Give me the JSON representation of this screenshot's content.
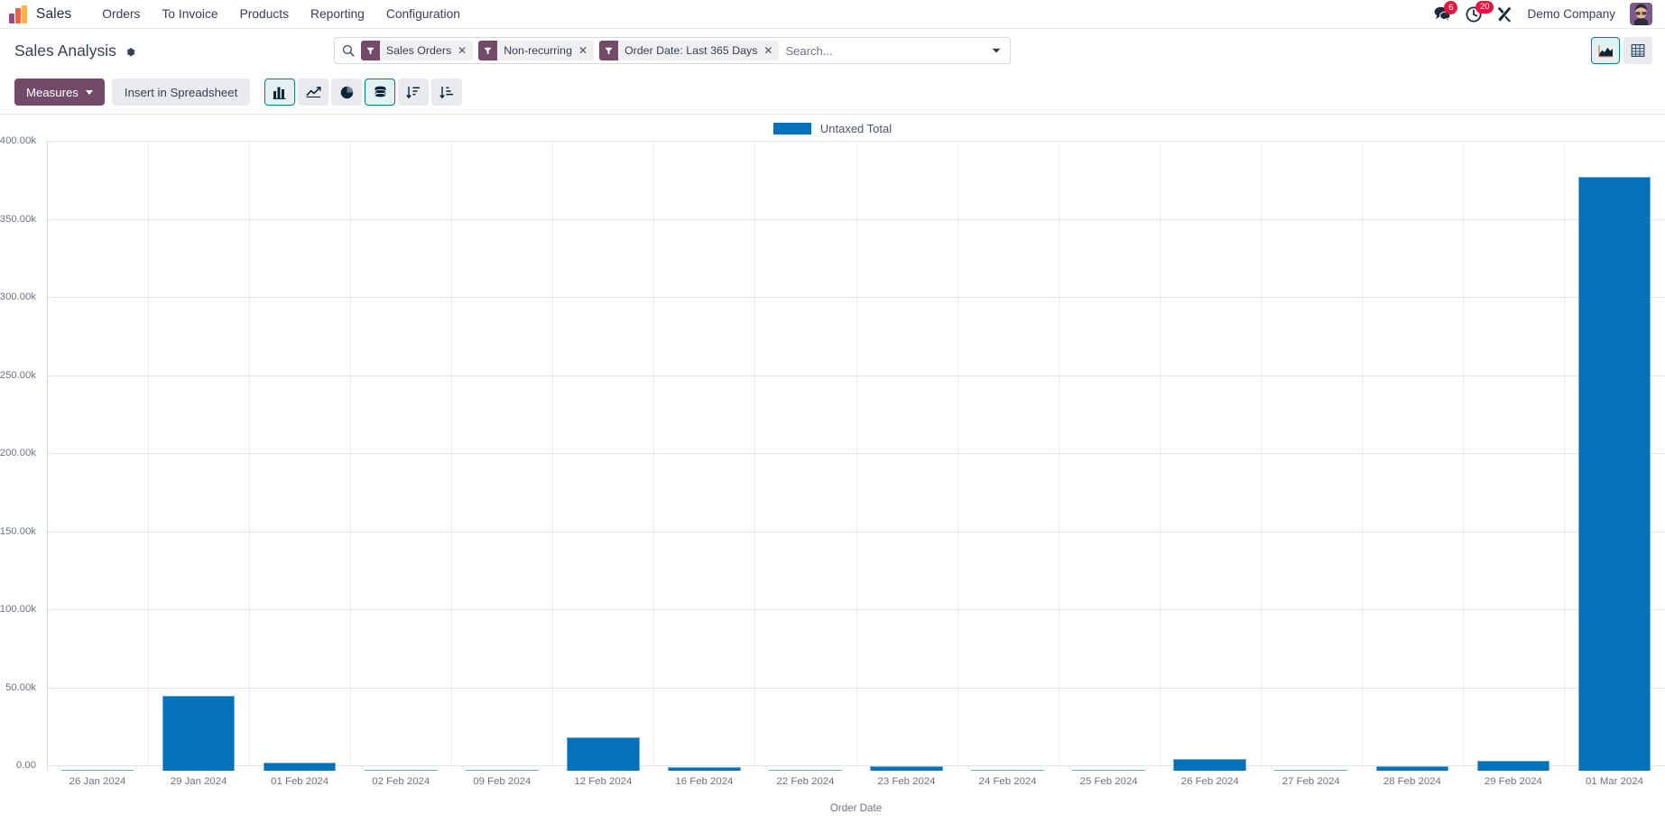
{
  "navbar": {
    "logo_icon": "odoo-logo-icon",
    "app_name": "Sales",
    "menu_items": [
      {
        "label": "Orders"
      },
      {
        "label": "To Invoice"
      },
      {
        "label": "Products"
      },
      {
        "label": "Reporting"
      },
      {
        "label": "Configuration"
      }
    ],
    "messages_icon": "chat-bubble-icon",
    "messages_count": "6",
    "activities_icon": "clock-icon",
    "activities_count": "20",
    "debug_icon": "tools-icon",
    "company": "Demo Company",
    "avatar_icon": "user-avatar"
  },
  "control_panel": {
    "title": "Sales Analysis",
    "settings_icon": "gear-icon",
    "search": {
      "search_icon": "search-icon",
      "placeholder": "Search...",
      "value": "",
      "dropdown_icon": "chevron-down-icon",
      "facets": [
        {
          "icon": "filter-icon",
          "label": "Sales Orders",
          "remove": "✕"
        },
        {
          "icon": "filter-icon",
          "label": "Non-recurring",
          "remove": "✕"
        },
        {
          "icon": "filter-icon",
          "label": "Order Date: Last 365 Days",
          "remove": "✕"
        }
      ]
    },
    "view_switcher": [
      {
        "name": "graph-view",
        "icon": "area-chart-icon",
        "active": true
      },
      {
        "name": "pivot-view",
        "icon": "table-grid-icon",
        "active": false
      }
    ],
    "toolbar": {
      "measures_label": "Measures",
      "spreadsheet_label": "Insert in Spreadsheet",
      "chart_buttons": [
        {
          "name": "bar-chart",
          "icon": "bar-chart-icon",
          "active": true
        },
        {
          "name": "line-chart",
          "icon": "line-chart-icon",
          "active": false
        },
        {
          "name": "pie-chart",
          "icon": "pie-chart-icon",
          "active": false
        },
        {
          "name": "stacked",
          "icon": "stacked-database-icon",
          "active": true
        },
        {
          "name": "sort-descending",
          "icon": "sort-descending-icon",
          "active": false
        },
        {
          "name": "sort-ascending",
          "icon": "sort-ascending-icon",
          "active": false
        }
      ]
    }
  },
  "chart_data": {
    "type": "bar",
    "title": "",
    "xlabel": "Order Date",
    "ylabel": "",
    "legend": [
      {
        "name": "Untaxed Total",
        "color": "#0571b8"
      }
    ],
    "legend_position": "top",
    "grid": true,
    "ylim": [
      0,
      400000
    ],
    "ytick_labels": [
      "0.00",
      "50.00k",
      "100.00k",
      "150.00k",
      "200.00k",
      "250.00k",
      "300.00k",
      "350.00k",
      "400.00k"
    ],
    "ytick_values": [
      0,
      50000,
      100000,
      150000,
      200000,
      250000,
      300000,
      350000,
      400000
    ],
    "categories": [
      "26 Jan 2024",
      "29 Jan 2024",
      "01 Feb 2024",
      "02 Feb 2024",
      "09 Feb 2024",
      "12 Feb 2024",
      "16 Feb 2024",
      "22 Feb 2024",
      "23 Feb 2024",
      "24 Feb 2024",
      "25 Feb 2024",
      "26 Feb 2024",
      "27 Feb 2024",
      "28 Feb 2024",
      "29 Feb 2024",
      "01 Mar 2024"
    ],
    "series": [
      {
        "name": "Untaxed Total",
        "color": "#0571b8",
        "values": [
          620,
          47800,
          5200,
          480,
          700,
          21200,
          2100,
          250,
          3100,
          450,
          430,
          7300,
          420,
          2900,
          6300,
          380600
        ]
      }
    ]
  }
}
